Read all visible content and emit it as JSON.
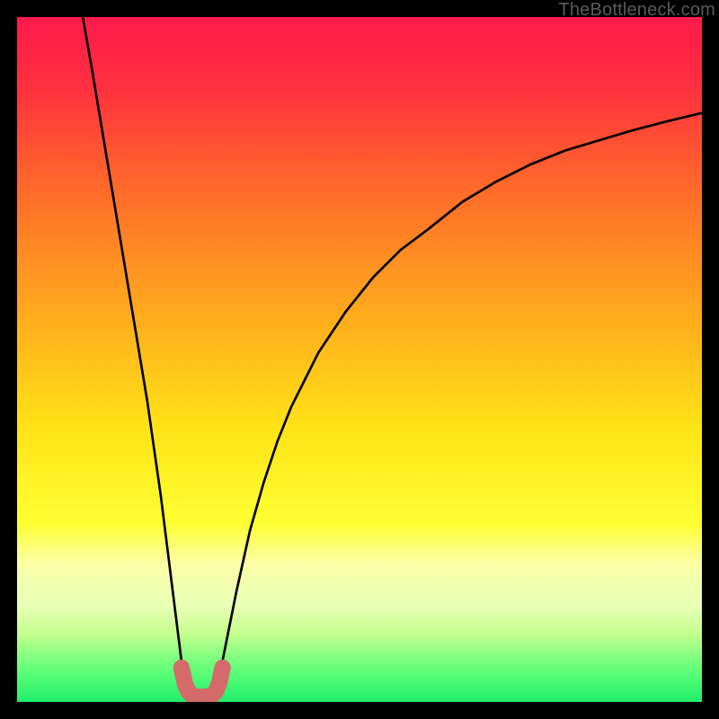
{
  "watermark": "TheBottleneck.com",
  "chart_data": {
    "type": "line",
    "title": "",
    "xlabel": "",
    "ylabel": "",
    "xlim": [
      0,
      100
    ],
    "ylim": [
      0,
      100
    ],
    "grid": false,
    "background_gradient": {
      "stops": [
        {
          "pos": 0.0,
          "color": "#ff1a4b"
        },
        {
          "pos": 0.1,
          "color": "#ff2f3f"
        },
        {
          "pos": 0.25,
          "color": "#ff6a2a"
        },
        {
          "pos": 0.45,
          "color": "#ffb01c"
        },
        {
          "pos": 0.6,
          "color": "#ffe317"
        },
        {
          "pos": 0.74,
          "color": "#ffff33"
        },
        {
          "pos": 0.8,
          "color": "#faffa8"
        },
        {
          "pos": 0.86,
          "color": "#e8ffb5"
        },
        {
          "pos": 0.9,
          "color": "#c5ff8f"
        },
        {
          "pos": 0.95,
          "color": "#66ff7a"
        },
        {
          "pos": 1.0,
          "color": "#1fef6a"
        }
      ]
    },
    "series": [
      {
        "name": "bottleneck-curve-left",
        "stroke": "#000000",
        "x": [
          9.6,
          11,
          12,
          13,
          14,
          15,
          16,
          17,
          18,
          19,
          20,
          21,
          22,
          23,
          24,
          24.5,
          25
        ],
        "y": [
          100,
          92,
          86,
          80,
          74,
          68,
          62,
          56,
          50,
          44,
          37,
          30,
          22,
          14,
          6,
          3,
          1.3
        ]
      },
      {
        "name": "bottleneck-curve-right",
        "stroke": "#000000",
        "x": [
          29,
          29.5,
          30,
          31,
          32,
          34,
          36,
          38,
          40,
          44,
          48,
          52,
          56,
          60,
          65,
          70,
          75,
          80,
          85,
          90,
          95,
          100
        ],
        "y": [
          1.3,
          3,
          6,
          11,
          16,
          25,
          32,
          38,
          43,
          51,
          57,
          62,
          66,
          69,
          73,
          76,
          78.5,
          80.5,
          82,
          83.5,
          84.8,
          86
        ]
      },
      {
        "name": "bottleneck-minimum-marker",
        "stroke": "#d46a6a",
        "thick": true,
        "x": [
          24,
          24.5,
          25,
          25.5,
          26,
          27,
          28,
          28.5,
          29,
          29.5,
          30
        ],
        "y": [
          5,
          2.7,
          1.5,
          1.0,
          0.8,
          0.7,
          0.8,
          1.0,
          1.5,
          2.7,
          5
        ]
      }
    ],
    "notes": "V-shaped bottleneck curve; minimum near x≈27. Values estimated from pixel positions on a 0–100 × 0–100 unit frame."
  }
}
